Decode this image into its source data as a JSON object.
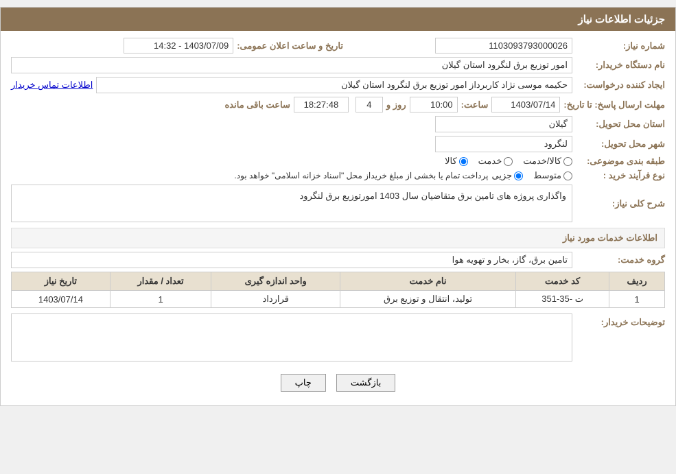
{
  "page": {
    "title": "جزئیات اطلاعات نیاز"
  },
  "header": {
    "title": "جزئیات اطلاعات نیاز"
  },
  "fields": {
    "need_number_label": "شماره نیاز:",
    "need_number_value": "1103093793000026",
    "announce_date_label": "تاریخ و ساعت اعلان عمومی:",
    "announce_date_value": "1403/07/09 - 14:32",
    "buyer_org_label": "نام دستگاه خریدار:",
    "buyer_org_value": "امور توزیع برق لنگرود استان گیلان",
    "creator_label": "ایجاد کننده درخواست:",
    "creator_value": "حکیمه موسی نژاد کاربرداز امور توزیع برق لنگرود استان گیلان",
    "contact_link": "اطلاعات تماس خریدار",
    "deadline_label": "مهلت ارسال پاسخ: تا تاریخ:",
    "deadline_date": "1403/07/14",
    "deadline_time_label": "ساعت:",
    "deadline_time": "10:00",
    "deadline_days_label": "روز و",
    "deadline_days": "4",
    "deadline_remaining_label": "ساعت باقی مانده",
    "deadline_remaining": "18:27:48",
    "province_label": "استان محل تحویل:",
    "province_value": "گیلان",
    "city_label": "شهر محل تحویل:",
    "city_value": "لنگرود",
    "category_label": "طبقه بندی موضوعی:",
    "category_kala": "کالا",
    "category_khedmat": "خدمت",
    "category_kala_khedmat": "کالا/خدمت",
    "process_type_label": "نوع فرآیند خرید :",
    "process_jozyi": "جزیی",
    "process_motawaset": "متوسط",
    "process_note": "پرداخت تمام یا بخشی از مبلغ خریداز محل \"اسناد خزانه اسلامی\" خواهد بود.",
    "need_description_label": "شرح کلی نیاز:",
    "need_description_value": "واگذاری پروژه های تامین برق متقاضیان سال 1403 امورتوزیع برق لنگرود",
    "services_section_label": "اطلاعات خدمات مورد نیاز",
    "service_group_label": "گروه خدمت:",
    "service_group_value": "تامین برق، گاز، بخار و تهویه هوا",
    "table": {
      "headers": [
        "ردیف",
        "کد خدمت",
        "نام خدمت",
        "واحد اندازه گیری",
        "تعداد / مقدار",
        "تاریخ نیاز"
      ],
      "rows": [
        {
          "row_num": "1",
          "code": "ت -35-351",
          "name": "تولید، انتقال و توزیع برق",
          "unit": "قرارداد",
          "quantity": "1",
          "date": "1403/07/14"
        }
      ]
    },
    "buyer_desc_label": "توضیحات خریدار:",
    "buyer_desc_value": "",
    "btn_back": "بازگشت",
    "btn_print": "چاپ"
  }
}
